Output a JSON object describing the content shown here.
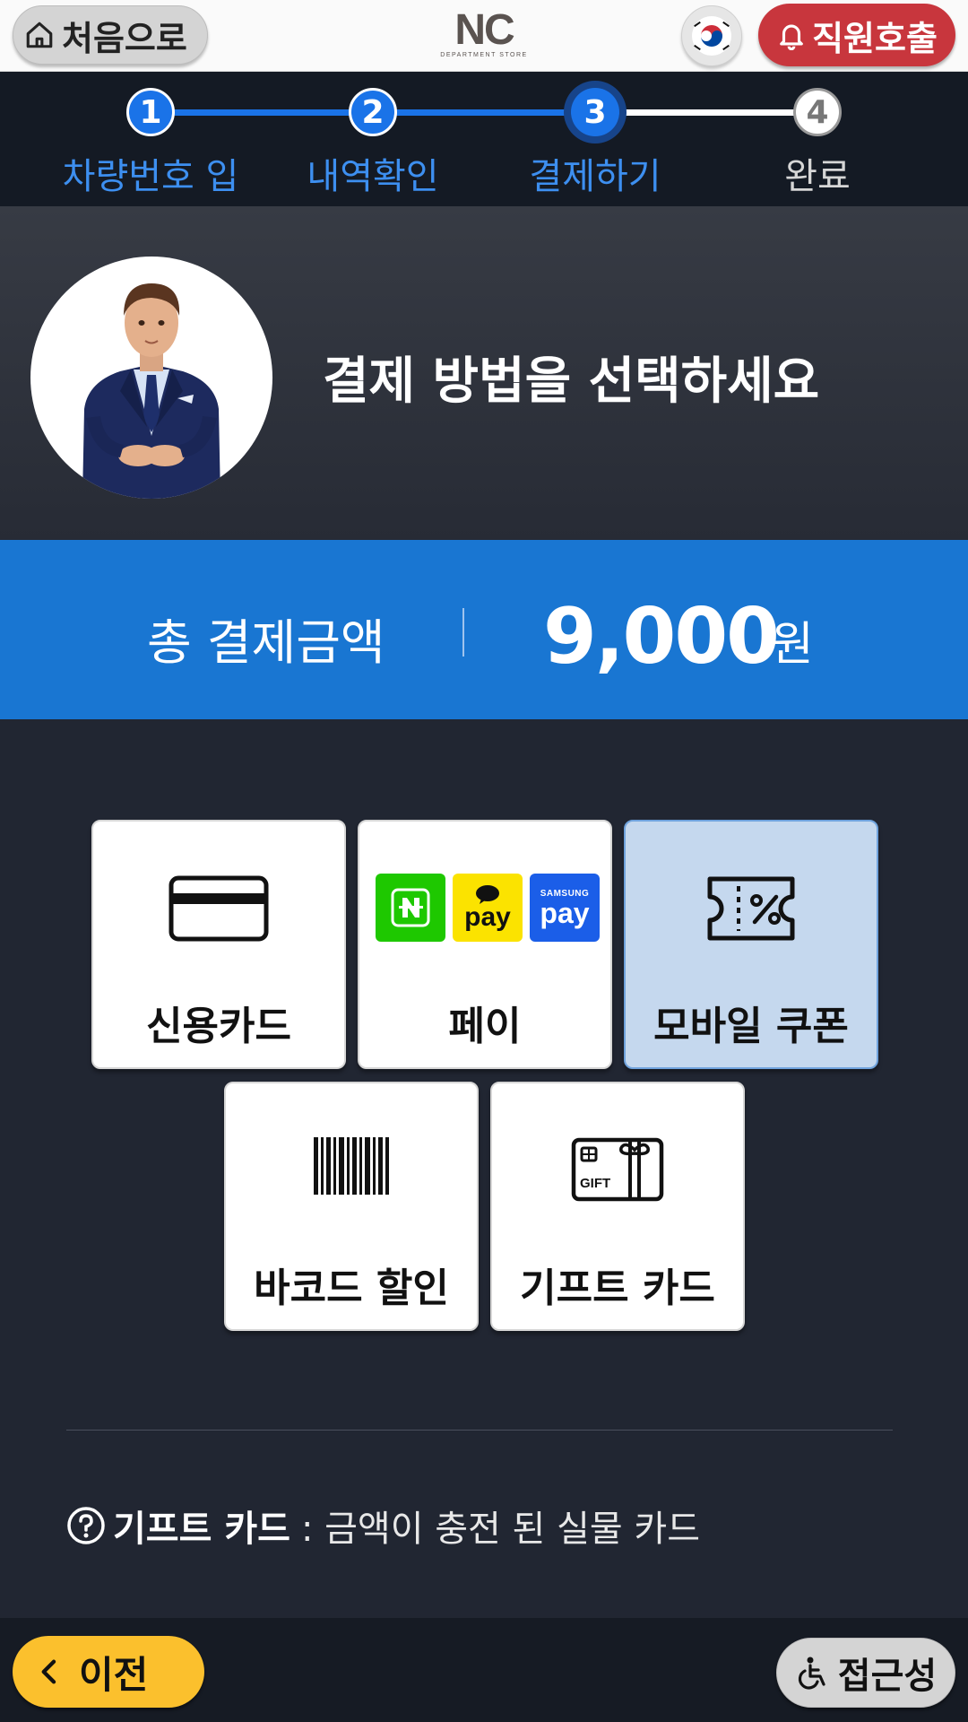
{
  "topbar": {
    "home_label": "처음으로",
    "logo_text": "NC",
    "logo_subtext": "DEPARTMENT STORE",
    "language_icon": "korea-flag-icon",
    "call_staff_label": "직원호출"
  },
  "stepper": {
    "steps": [
      {
        "number": "1",
        "label": "차량번호 입력",
        "state": "done"
      },
      {
        "number": "2",
        "label": "내역확인",
        "state": "done"
      },
      {
        "number": "3",
        "label": "결제하기",
        "state": "current"
      },
      {
        "number": "4",
        "label": "완료",
        "state": "todo"
      }
    ]
  },
  "hero": {
    "title": "결제 방법을 선택하세요"
  },
  "total": {
    "label": "총 결제금액",
    "amount": "9,000",
    "unit": "원"
  },
  "payment_methods": [
    {
      "label": "신용카드",
      "icon": "credit-card-icon",
      "selected": false
    },
    {
      "label": "페이",
      "icon": "pay-logos",
      "logos": [
        "N",
        "pay",
        "SAMSUNG pay"
      ],
      "selected": false
    },
    {
      "label": "모바일 쿠폰",
      "icon": "coupon-icon",
      "selected": true
    },
    {
      "label": "바코드 할인",
      "icon": "barcode-icon",
      "selected": false
    },
    {
      "label": "기프트 카드",
      "icon": "gift-card-icon",
      "selected": false
    }
  ],
  "info": {
    "title": "기프트 카드",
    "description": ": 금액이 충전 된 실물 카드"
  },
  "bottombar": {
    "prev_label": "이전",
    "accessibility_label": "접근성"
  },
  "colors": {
    "accent_blue": "#1976d2",
    "call_red": "#c8363d",
    "prev_yellow": "#fbc02d",
    "selected_card": "#c5d8ee"
  }
}
